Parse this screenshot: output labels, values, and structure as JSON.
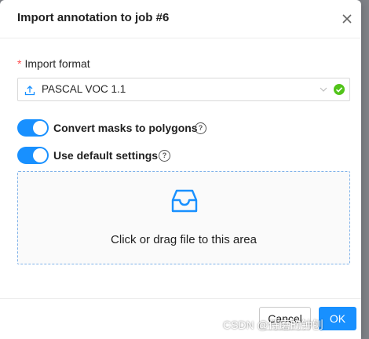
{
  "dialog": {
    "title": "Import annotation to job #6"
  },
  "form": {
    "format_label": "Import format",
    "required_mark": "*",
    "format_value": "PASCAL VOC 1.1",
    "switches": [
      {
        "label": "Convert masks to polygons",
        "on": true
      },
      {
        "label": "Use default settings",
        "on": true
      }
    ],
    "help_glyph": "?",
    "dropzone_text": "Click or drag file to this area"
  },
  "footer": {
    "cancel_label": "Cancel",
    "ok_label": "OK"
  },
  "watermark": "CSDN @侍磨的钟刨",
  "colors": {
    "primary": "#1890ff",
    "success": "#52c41a",
    "required": "#ff4d4f"
  }
}
